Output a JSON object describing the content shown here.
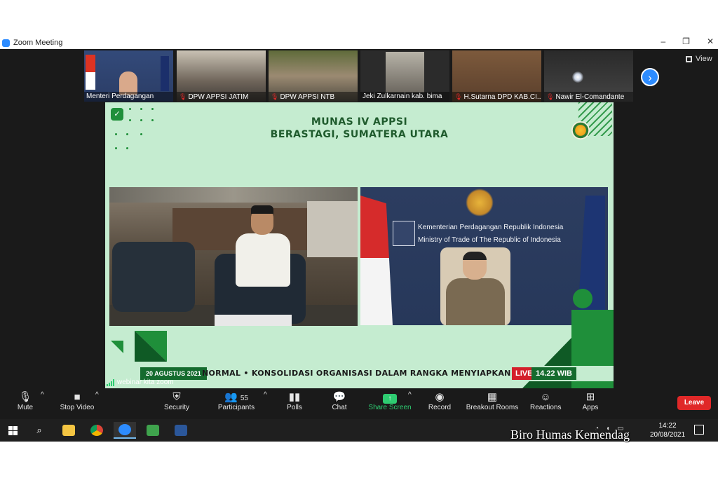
{
  "window": {
    "title": "Zoom Meeting",
    "controls": [
      "–",
      "❐",
      "✕"
    ]
  },
  "thumbnails": [
    {
      "name": "Menteri Perdagangan",
      "muted": false
    },
    {
      "name": "DPW APPSI JATIM",
      "muted": true
    },
    {
      "name": "DPW APPSI NTB",
      "muted": true
    },
    {
      "name": "Jeki Zulkarnain kab. bima",
      "muted": false
    },
    {
      "name": "H.Sutarna DPD KAB.CI...",
      "muted": true
    },
    {
      "name": "Nawir El-Comandante",
      "muted": true
    }
  ],
  "view_button": "View",
  "share": {
    "title_line1": "MUNAS IV APPSI",
    "title_line2": "BERASTAGI, SUMATERA UTARA",
    "ministry_line1": "Kementerian Perdagangan Republik Indonesia",
    "ministry_line2": "Ministry of Trade of The Republic of Indonesia",
    "ticker": {
      "date": "20 AGUSTUS 2021",
      "text": "NORMAL   •   KONSOLIDASI ORGANISASI DALAM RANGKA MENYIAPKAN PEDAGA",
      "live": "LIVE",
      "time": "14.22 WIB"
    },
    "network_label": "webinar kita zoom"
  },
  "toolbar": {
    "mute": "Mute",
    "stop_video": "Stop Video",
    "security": "Security",
    "participants": "Participants",
    "participants_count": "55",
    "polls": "Polls",
    "chat": "Chat",
    "share_screen": "Share Screen",
    "record": "Record",
    "breakout_rooms": "Breakout Rooms",
    "reactions": "Reactions",
    "apps": "Apps",
    "leave": "Leave"
  },
  "taskbar": {
    "time": "14:22",
    "date": "20/08/2021"
  },
  "watermark": "Biro Humas Kemendag",
  "colors": {
    "zoom_blue": "#2d8cff",
    "share_green": "#2ecc71",
    "leave_red": "#e02828",
    "slide_bg": "#c5ecd0",
    "slide_green": "#1f8f3a"
  }
}
